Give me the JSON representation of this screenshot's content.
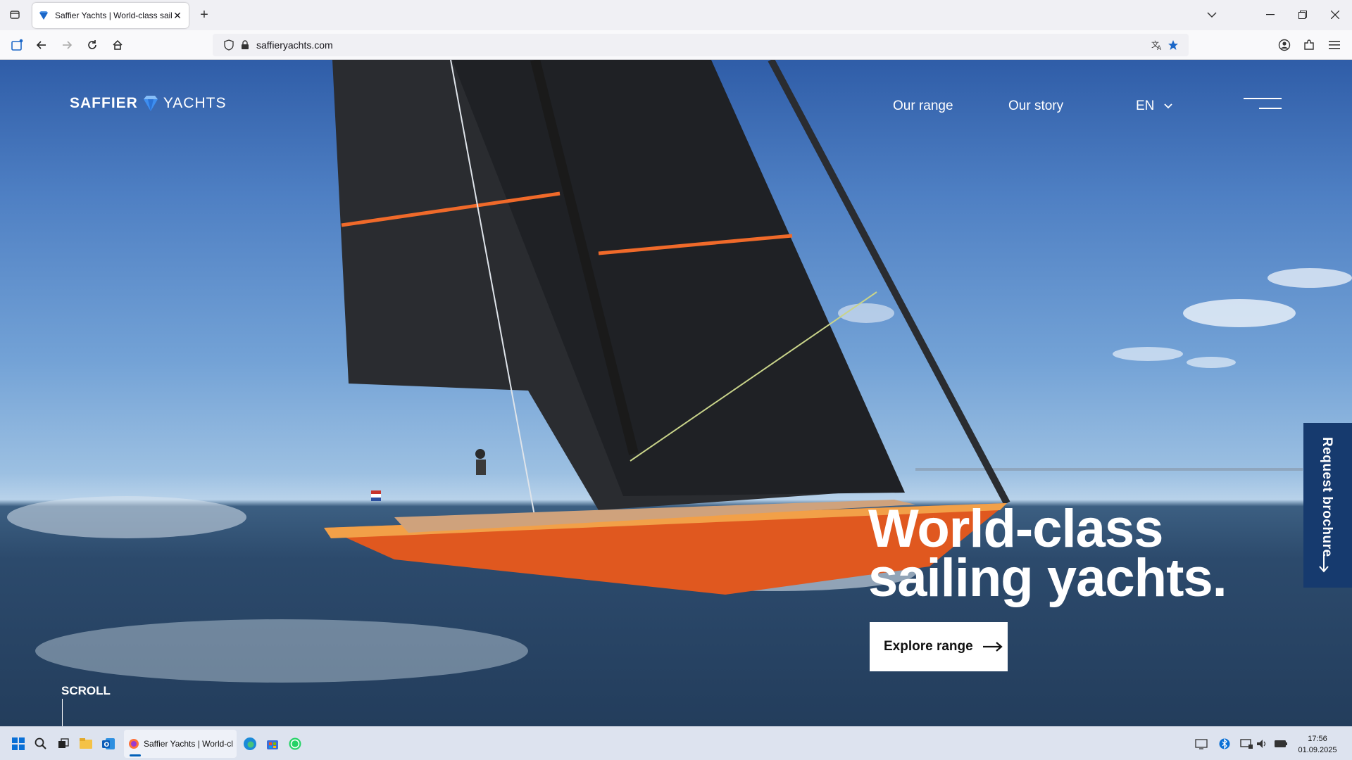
{
  "browser": {
    "tab_title": "Saffier Yachts | World-class sailing yachts",
    "url": "saffieryachts.com"
  },
  "site": {
    "logo_bold": "SAFFIER",
    "logo_light": "YACHTS",
    "nav": [
      "Our range",
      "Our story"
    ],
    "language": "EN",
    "headline_line1": "World-class",
    "headline_line2": "sailing yachts.",
    "cta_label": "Explore range",
    "brochure_label": "Request brochure",
    "scroll_label": "SCROLL",
    "colors": {
      "accent": "#163a6e",
      "hull": "#e0581f",
      "sail": "#2a2c30"
    }
  },
  "taskbar": {
    "app_label": "Saffier Yachts | World-cl",
    "time": "17:56",
    "date": "01.09.2025"
  }
}
